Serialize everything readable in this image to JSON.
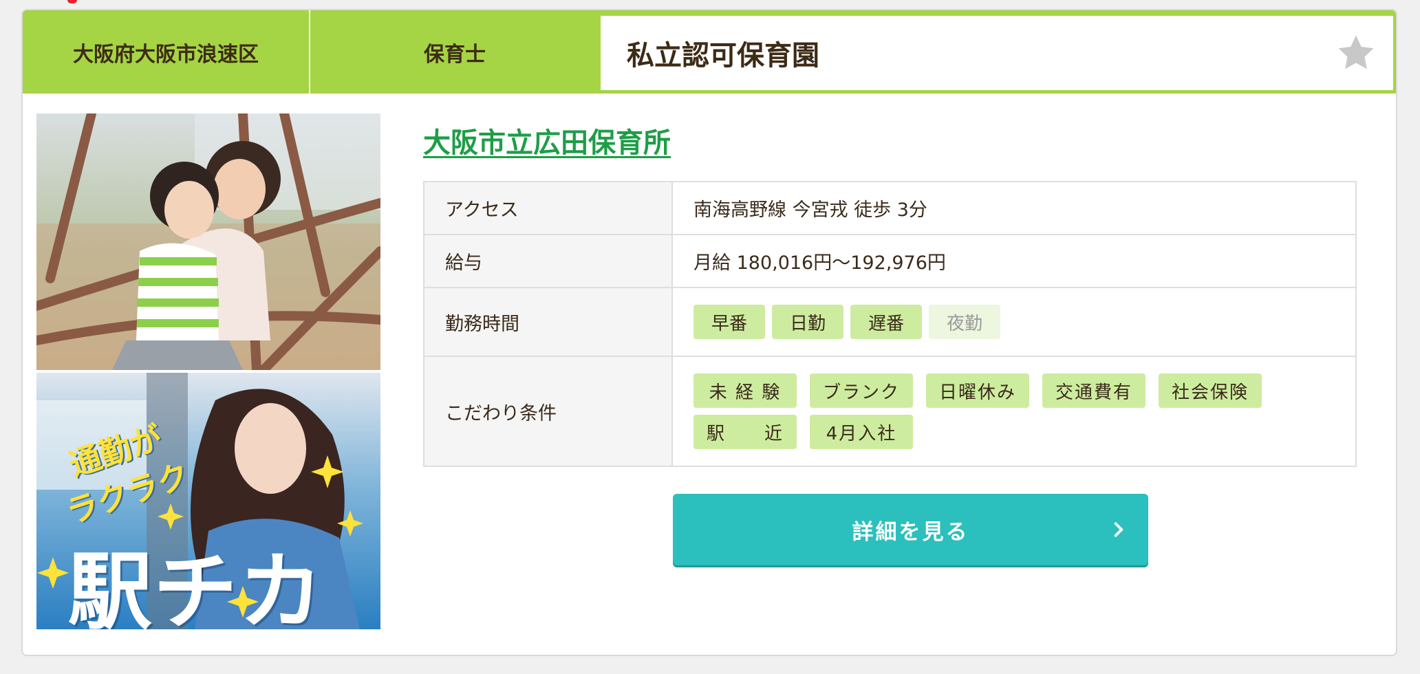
{
  "header": {
    "area": "大阪府大阪市浪速区",
    "job": "保育士",
    "facility_type": "私立認可保育園"
  },
  "facility": {
    "name": "大阪市立広田保育所"
  },
  "info_table": {
    "access": {
      "label": "アクセス",
      "value": "南海高野線 今宮戎 徒歩 3分"
    },
    "salary": {
      "label": "給与",
      "value": "月給 180,016円〜192,976円"
    },
    "hours": {
      "label": "勤務時間",
      "tags": [
        {
          "text": "早番",
          "active": true
        },
        {
          "text": "日勤",
          "active": true
        },
        {
          "text": "遅番",
          "active": true
        },
        {
          "text": "夜勤",
          "active": false
        }
      ]
    },
    "conditions": {
      "label": "こだわり条件",
      "tags": [
        "未 経 験",
        "ブランク",
        "日曜休み",
        "交通費有",
        "社会保険",
        "駅　　近",
        "4月入社"
      ]
    }
  },
  "banner": {
    "catch_line_1": "通勤が",
    "catch_line_2": "ラクラク",
    "big_text": "駅チカ"
  },
  "detail_button": {
    "label": "詳細を見る"
  },
  "icons": {
    "favorite": "star-icon",
    "button_arrow": "chevron-right-icon"
  },
  "colors": {
    "header_green": "#a5d444",
    "link_green": "#1e9d47",
    "tag_green": "#cdeca0",
    "button_teal": "#2bbfbd"
  }
}
